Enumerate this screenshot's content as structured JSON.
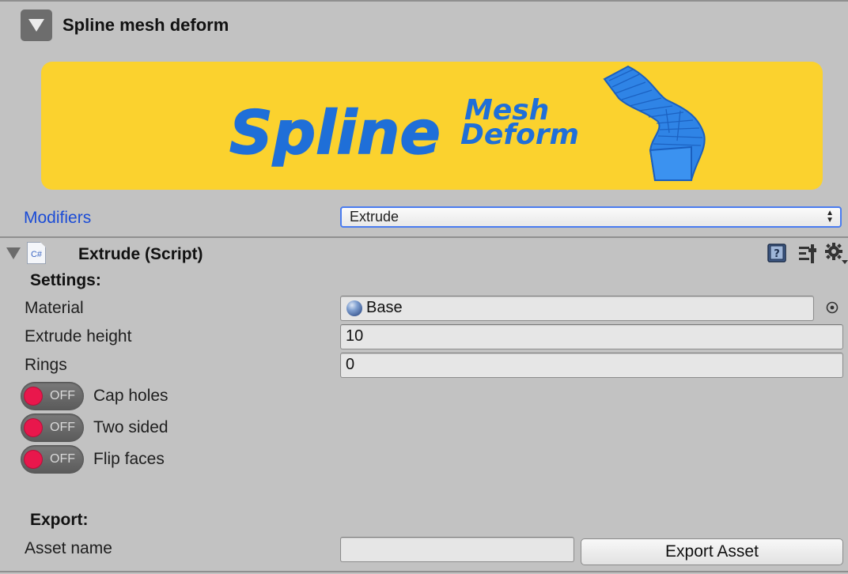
{
  "header": {
    "title": "Spline mesh deform"
  },
  "banner": {
    "logo_word": "Spline",
    "logo_line1": "Mesh",
    "logo_line2": "Deform"
  },
  "modifiers": {
    "label": "Modifiers",
    "selected": "Extrude"
  },
  "component": {
    "script_icon_text": "C#",
    "title": "Extrude (Script)",
    "icons": [
      "help-icon",
      "presets-icon",
      "gear-icon"
    ]
  },
  "settings": {
    "heading": "Settings:",
    "material_label": "Material",
    "material_value": "Base",
    "extrude_height_label": "Extrude height",
    "extrude_height_value": "10",
    "rings_label": "Rings",
    "rings_value": "0",
    "toggles": [
      {
        "label": "Cap holes",
        "state": "OFF"
      },
      {
        "label": "Two sided",
        "state": "OFF"
      },
      {
        "label": "Flip faces",
        "state": "OFF"
      }
    ]
  },
  "export": {
    "heading": "Export:",
    "asset_name_label": "Asset name",
    "asset_name_value": "",
    "button_label": "Export Asset"
  },
  "colors": {
    "background": "#c2c2c2",
    "banner": "#fbd22e",
    "logo_blue": "#1f6fd8",
    "link_blue": "#1a4bd6",
    "toggle_off": "#e9174c"
  }
}
